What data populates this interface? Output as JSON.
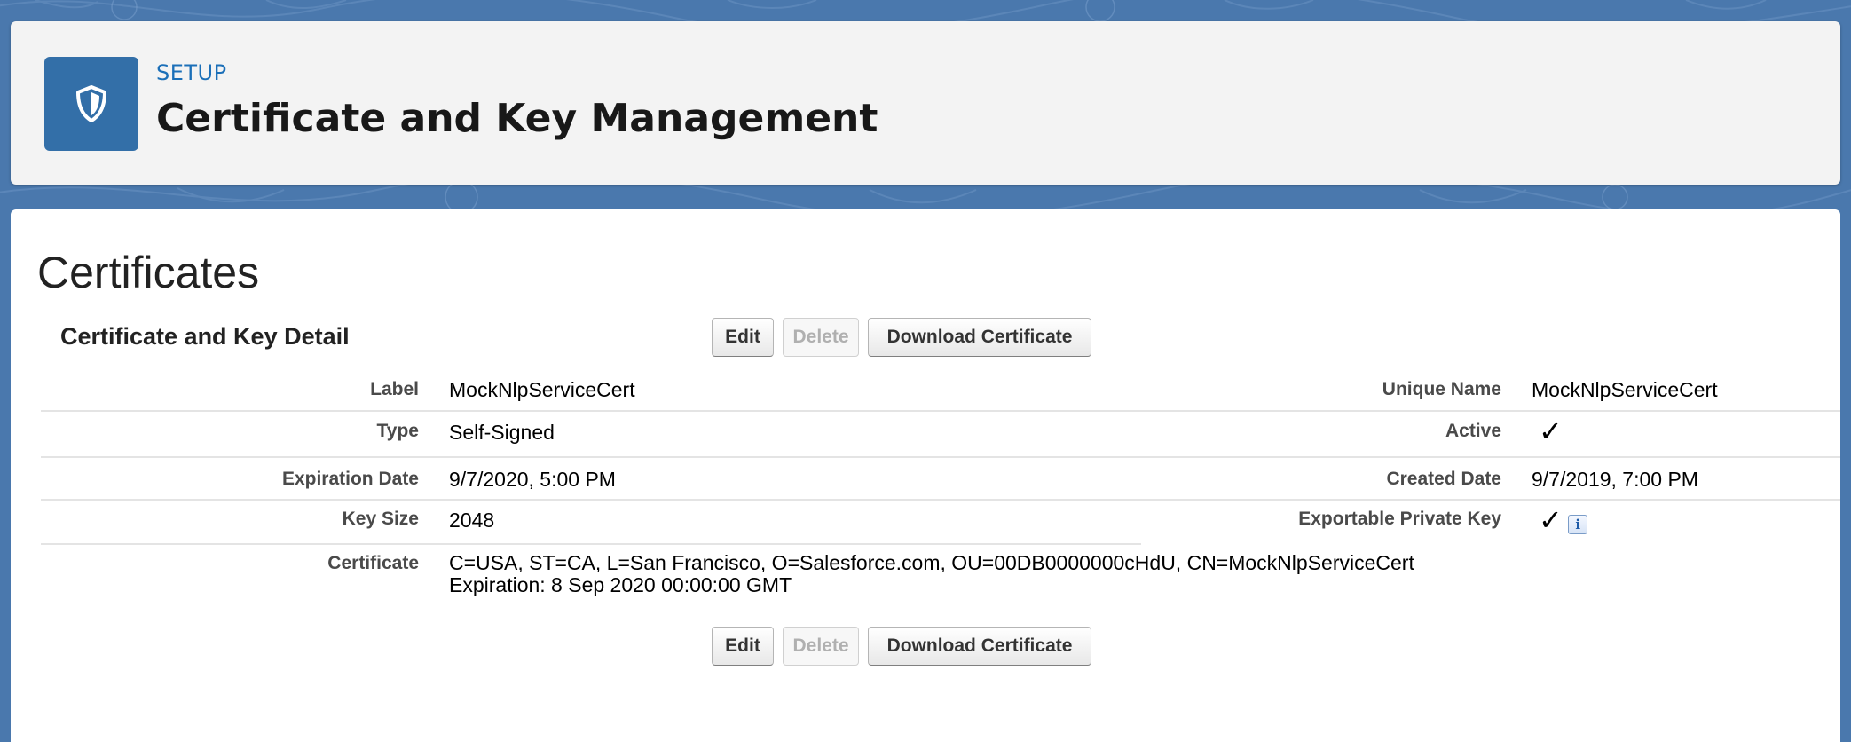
{
  "header": {
    "eyebrow": "SETUP",
    "title": "Certificate and Key Management",
    "icon": "shield-icon"
  },
  "main": {
    "section_title": "Certificates",
    "detail_title": "Certificate and Key Detail",
    "buttons": {
      "edit": "Edit",
      "delete": "Delete",
      "download": "Download Certificate"
    },
    "fields": {
      "label": {
        "label": "Label",
        "value": "MockNlpServiceCert"
      },
      "unique_name": {
        "label": "Unique Name",
        "value": "MockNlpServiceCert"
      },
      "type": {
        "label": "Type",
        "value": "Self-Signed"
      },
      "active": {
        "label": "Active",
        "value": "✓"
      },
      "expiration_date": {
        "label": "Expiration Date",
        "value": "9/7/2020, 5:00 PM"
      },
      "created_date": {
        "label": "Created Date",
        "value": "9/7/2019, 7:00 PM"
      },
      "key_size": {
        "label": "Key Size",
        "value": "2048"
      },
      "exportable_private_key": {
        "label": "Exportable Private Key",
        "value": "✓",
        "info": "i"
      },
      "certificate": {
        "label": "Certificate",
        "line1": "C=USA, ST=CA, L=San Francisco, O=Salesforce.com, OU=00DB0000000cHdU, CN=MockNlpServiceCert",
        "line2": "Expiration: 8 Sep 2020 00:00:00 GMT"
      }
    }
  },
  "colors": {
    "background": "#4a78ad",
    "icon_bg": "#336fa8",
    "eyebrow": "#1b6fb8"
  }
}
